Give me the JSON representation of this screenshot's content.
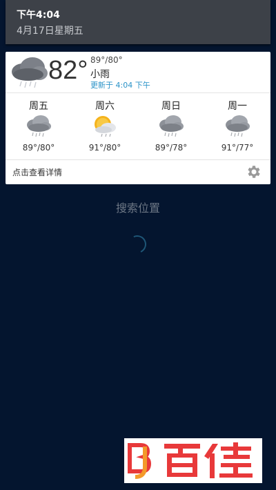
{
  "notification": {
    "time": "下午4:04",
    "date": "4月17日星期五"
  },
  "weather": {
    "current_temp": "82°",
    "hi_lo": "89°/80°",
    "condition": "小雨",
    "updated": "更新于 4:04 下午",
    "condition_icon": "rain-cloud-icon"
  },
  "forecast": [
    {
      "day": "周五",
      "range": "89°/80°",
      "icon": "rain-cloud-icon"
    },
    {
      "day": "周六",
      "range": "91°/80°",
      "icon": "partly-sunny-rain-icon"
    },
    {
      "day": "周日",
      "range": "89°/78°",
      "icon": "rain-cloud-icon"
    },
    {
      "day": "周一",
      "range": "91°/77°",
      "icon": "rain-cloud-icon"
    }
  ],
  "footer": {
    "details_label": "点击查看详情",
    "settings_icon": "gear-icon"
  },
  "search_location": "搜索位置",
  "logo": {
    "text": "百佳",
    "mark": "BJ",
    "colors": {
      "red": "#e8393a",
      "orange": "#f39a2a"
    }
  }
}
